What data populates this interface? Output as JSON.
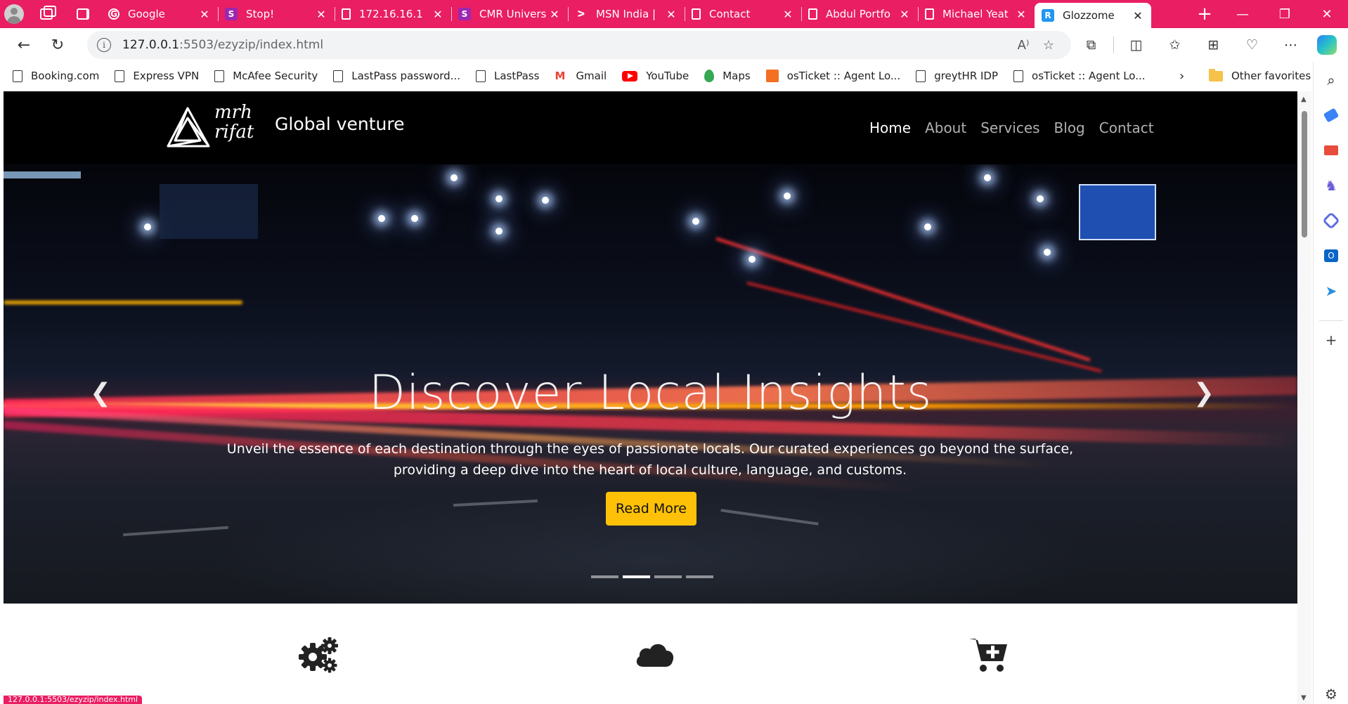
{
  "browser": {
    "tabs": [
      {
        "title": "Google",
        "icon": "google-icon"
      },
      {
        "title": "Stop!",
        "icon": "s-icon"
      },
      {
        "title": "172.16.16.1",
        "icon": "page-icon"
      },
      {
        "title": "CMR Univers",
        "icon": "s-icon"
      },
      {
        "title": "MSN India |",
        "icon": "msn-icon"
      },
      {
        "title": "Contact",
        "icon": "page-icon"
      },
      {
        "title": "Abdul Portfo",
        "icon": "page-icon"
      },
      {
        "title": "Michael Yeat",
        "icon": "page-icon"
      },
      {
        "title": "Glozzome",
        "icon": "r-icon",
        "active": true
      }
    ],
    "address": {
      "host": "127.0.0.1",
      "rest": ":5503/ezyzip/index.html"
    },
    "bookmarks": [
      "Booking.com",
      "Express VPN",
      "McAfee Security",
      "LastPass password...",
      "LastPass",
      "Gmail",
      "YouTube",
      "Maps",
      "osTicket :: Agent Lo...",
      "greytHR IDP",
      "osTicket :: Agent Lo..."
    ],
    "other_favorites": "Other favorites",
    "status_url": "127.0.0.1:5503/ezyzip/index.html",
    "accent": "#e91e63"
  },
  "site": {
    "logo_script_1": "mrh",
    "logo_script_2": "rifat",
    "brand": "Global venture",
    "nav": [
      "Home",
      "About",
      "Services",
      "Blog",
      "Contact"
    ],
    "hero": {
      "title": "Discover Local Insights",
      "text": "Unveil the essence of each destination through the eyes of passionate locals. Our curated experiences go beyond the surface, providing a deep dive into the heart of local culture, language, and customs.",
      "button": "Read More",
      "button_color": "#ffc107",
      "slides": 4,
      "active_slide": 2
    },
    "features": [
      "gears-icon",
      "cloud-icon",
      "cart-plus-icon"
    ]
  }
}
